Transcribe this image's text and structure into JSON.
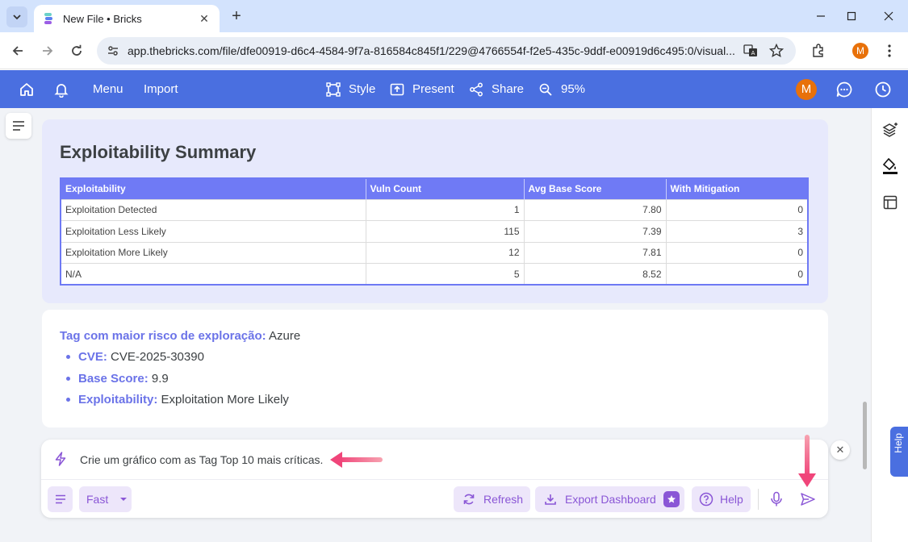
{
  "browser": {
    "tab_title": "New File • Bricks",
    "url": "app.thebricks.com/file/dfe00919-d6c4-4584-9f7a-816584c845f1/229@4766554f-f2e5-435c-9ddf-e00919d6c495:0/visual...",
    "profile_initial": "M"
  },
  "appbar": {
    "menu": "Menu",
    "import": "Import",
    "style": "Style",
    "present": "Present",
    "share": "Share",
    "zoom": "95%",
    "avatar_initial": "M"
  },
  "summary_card": {
    "title": "Exploitability Summary",
    "columns": [
      "Exploitability",
      "Vuln Count",
      "Avg Base Score",
      "With Mitigation"
    ],
    "rows": [
      [
        "Exploitation Detected",
        "1",
        "7.80",
        "0"
      ],
      [
        "Exploitation Less Likely",
        "115",
        "7.39",
        "3"
      ],
      [
        "Exploitation More Likely",
        "12",
        "7.81",
        "0"
      ],
      [
        "N/A",
        "5",
        "8.52",
        "0"
      ]
    ]
  },
  "insight_card": {
    "headline_label": "Tag com maior risco de exploração:",
    "headline_value": " Azure",
    "bullets": [
      {
        "label": "CVE:",
        "value": " CVE-2025-30390"
      },
      {
        "label": "Base Score:",
        "value": " 9.9"
      },
      {
        "label": "Exploitability:",
        "value": " Exploitation More Likely"
      }
    ]
  },
  "chat": {
    "prompt": "Crie um gráfico com as Tag Top 10 mais críticas.",
    "mode": "Fast",
    "refresh": "Refresh",
    "export": "Export Dashboard",
    "help": "Help"
  },
  "help_tab": "Help",
  "colors": {
    "brand_blue": "#4a6fe0",
    "table_header": "#6f7af5",
    "accent_purple": "#8a56d6",
    "annotation_pink": "#f0457a"
  }
}
